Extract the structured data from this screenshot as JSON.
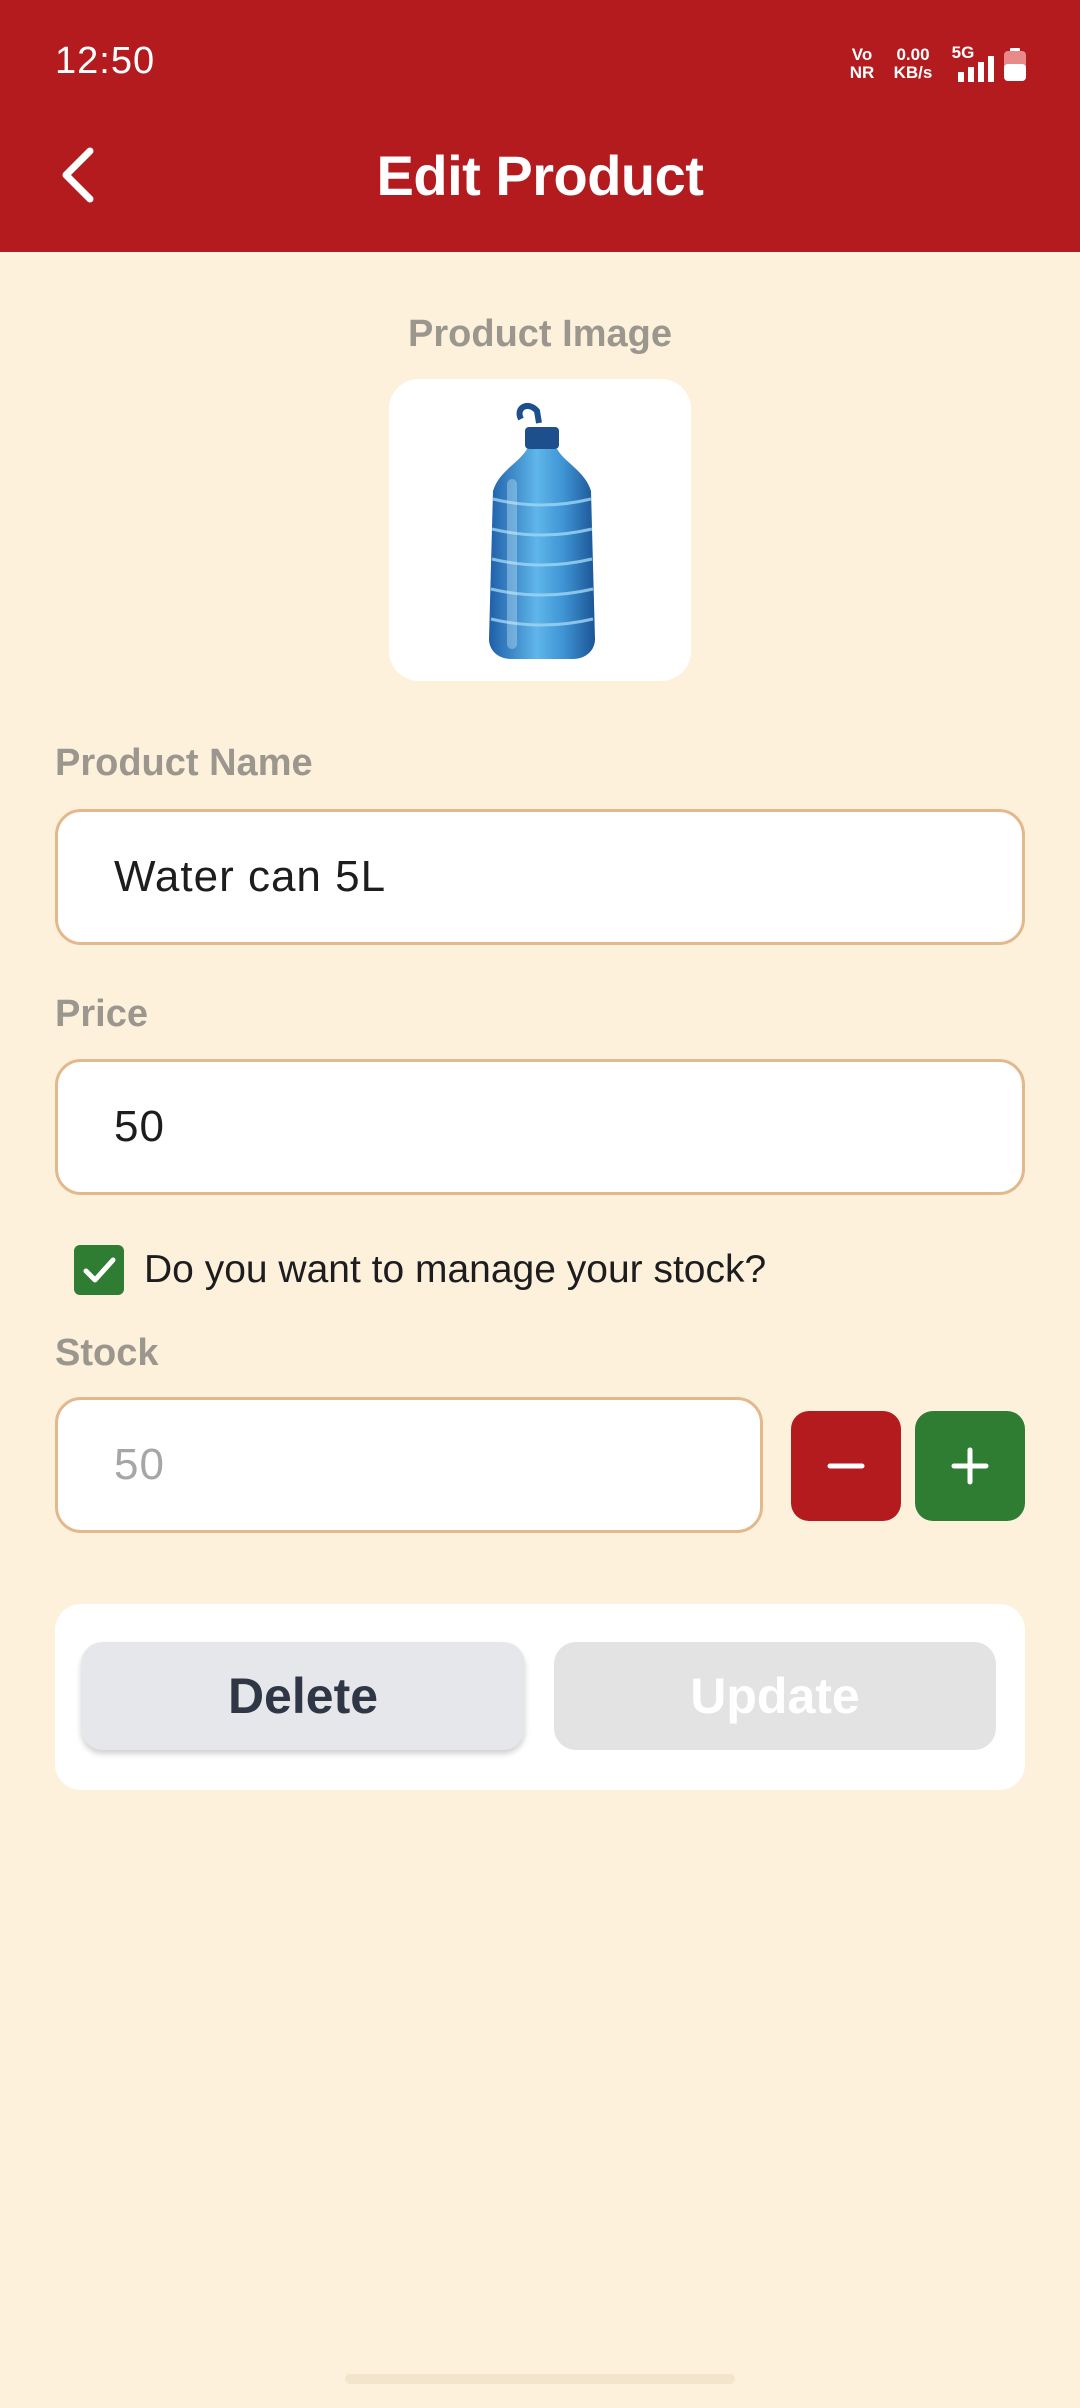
{
  "status_bar": {
    "time": "12:50",
    "network_line1": "Vo",
    "network_line2": "NR",
    "speed_value": "0.00",
    "speed_unit": "KB/s",
    "signal_label": "5G"
  },
  "header": {
    "title": "Edit Product",
    "back_icon": "chevron-left-icon",
    "background": "#b41b1f"
  },
  "product_image": {
    "label": "Product Image",
    "image": "water-bottle"
  },
  "product_name": {
    "label": "Product Name",
    "value": "Water can 5L"
  },
  "price": {
    "label": "Price",
    "value": "50"
  },
  "manage_stock": {
    "checked": true,
    "label": "Do you want to manage your stock?"
  },
  "stock": {
    "label": "Stock",
    "placeholder": "50",
    "decrement_icon": "minus-icon",
    "increment_icon": "plus-icon"
  },
  "actions": {
    "delete_label": "Delete",
    "update_label": "Update"
  },
  "colors": {
    "accent_red": "#b41b1f",
    "accent_green": "#2e7d32",
    "background": "#fdf1dc",
    "field_border": "#e2b88c"
  }
}
